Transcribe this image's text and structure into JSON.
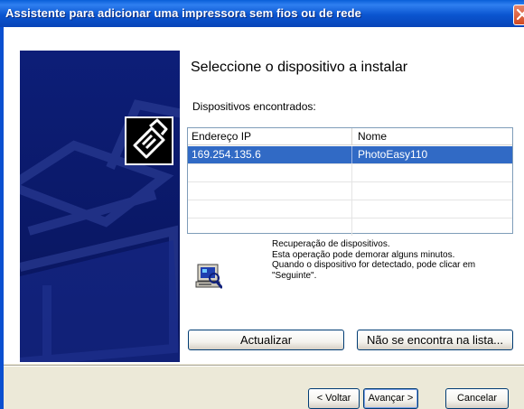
{
  "window": {
    "title": "Assistente para adicionar uma impressora sem fios ou de rede"
  },
  "page": {
    "heading": "Seleccione o dispositivo a instalar",
    "devices_label": "Dispositivos encontrados:"
  },
  "device_list": {
    "columns": [
      "Endereço IP",
      "Nome"
    ],
    "rows": [
      {
        "ip": "169.254.135.6",
        "name": "PhotoEasy110",
        "selected": true
      }
    ],
    "empty_rows": 4
  },
  "recovery": {
    "lines": [
      "Recuperação de dispositivos.",
      "Esta operação pode demorar alguns minutos.",
      "Quando o dispositivo for detectado, pode clicar em",
      "\"Seguinte\"."
    ],
    "icon": "computer-search-icon"
  },
  "buttons": {
    "refresh": "Actualizar",
    "not_in_list": "Não se encontra na lista...",
    "back": "< Voltar",
    "next": "Avançar >",
    "cancel": "Cancelar"
  },
  "colors": {
    "titlebar": "#0a55d0",
    "selection": "#316ac5",
    "wizard_panel": "#0c1a6e",
    "dialog_background": "#ece9d8"
  },
  "icons": {
    "close": "close-icon",
    "printer": "printer-icon"
  }
}
